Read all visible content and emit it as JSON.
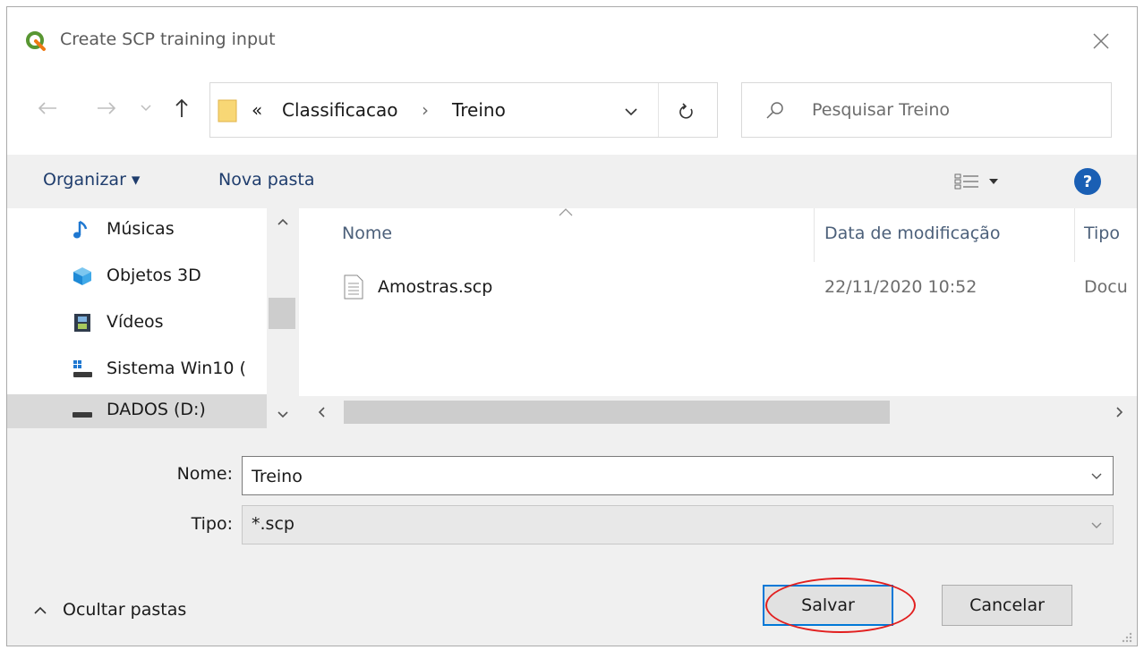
{
  "window": {
    "title": "Create SCP training input",
    "app_icon": "qgis-logo-icon",
    "close_icon": "close-icon"
  },
  "nav": {
    "back_icon": "back-arrow-icon",
    "forward_icon": "forward-arrow-icon",
    "recent_icon": "chevron-down-icon",
    "up_icon": "up-arrow-icon",
    "breadcrumb_prefix": "«",
    "breadcrumb": [
      "Classificacao",
      "Treino"
    ],
    "breadcrumb_separator": "›",
    "refresh_icon": "refresh-icon",
    "search_placeholder": "Pesquisar Treino"
  },
  "toolbar": {
    "organize_label": "Organizar ▾",
    "new_folder_label": "Nova pasta",
    "view_icon": "view-options-icon",
    "help_icon": "help-icon",
    "help_glyph": "?"
  },
  "sidebar": {
    "items": [
      {
        "label": "Músicas",
        "icon": "music-note-icon"
      },
      {
        "label": "Objetos 3D",
        "icon": "cube-3d-icon"
      },
      {
        "label": "Vídeos",
        "icon": "video-film-icon"
      },
      {
        "label": "Sistema Win10 (",
        "icon": "system-drive-icon"
      },
      {
        "label": "DADOS (D:)",
        "icon": "drive-icon",
        "selected": true
      }
    ]
  },
  "filelist": {
    "columns": [
      "Nome",
      "Data de modificação",
      "Tipo"
    ],
    "rows": [
      {
        "name": "Amostras.scp",
        "date": "22/11/2020 10:52",
        "type": "Docu"
      }
    ]
  },
  "form": {
    "name_label": "Nome:",
    "name_value": "Treino",
    "type_label": "Tipo:",
    "type_value": "*.scp",
    "hide_folders_label": "Ocultar pastas",
    "save_label": "Salvar",
    "cancel_label": "Cancelar"
  },
  "colors": {
    "accent": "#0078d7",
    "highlight_circle": "#e21f1f",
    "help": "#1a5fb4"
  }
}
